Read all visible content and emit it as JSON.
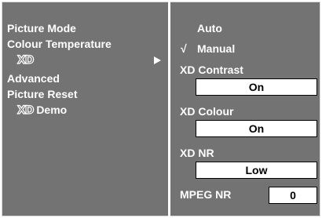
{
  "menu": {
    "items": [
      {
        "label": "Picture Mode"
      },
      {
        "label": "Colour Temperature"
      },
      {
        "logo": "XD",
        "selected": true
      },
      {
        "label": "Advanced"
      },
      {
        "label": "Picture Reset"
      },
      {
        "logo": "XD",
        "label": "Demo"
      }
    ]
  },
  "submenu": {
    "options": [
      {
        "label": "Auto",
        "checked": false
      },
      {
        "label": "Manual",
        "checked": true,
        "check_mark": "√"
      }
    ],
    "xd_contrast": {
      "label": "XD Contrast",
      "value": "On"
    },
    "xd_colour": {
      "label": "XD Colour",
      "value": "On"
    },
    "xd_nr": {
      "label": "XD NR",
      "value": "Low"
    },
    "mpeg_nr": {
      "label": "MPEG NR",
      "value": "0"
    }
  },
  "colors": {
    "panel": "#737373",
    "text": "#ffffff",
    "box": "#ffffff",
    "box_text": "#000000"
  }
}
